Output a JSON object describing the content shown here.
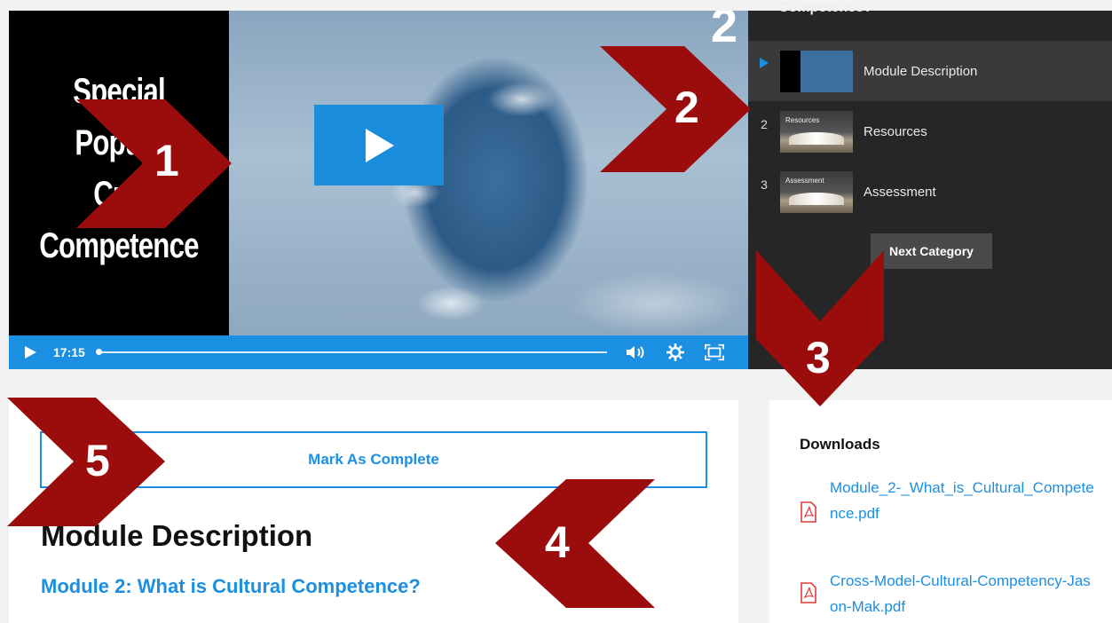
{
  "player": {
    "poster_lines": [
      "Special",
      "Popula",
      "Cult",
      "Competence"
    ],
    "corner_number": "2",
    "current_time": "17:15"
  },
  "playlist": {
    "title": "Competence?",
    "items": [
      {
        "index": "",
        "label": "Module Description",
        "thumb_text": ""
      },
      {
        "index": "2",
        "label": "Resources",
        "thumb_text": "Resources"
      },
      {
        "index": "3",
        "label": "Assessment",
        "thumb_text": "Assessment"
      }
    ],
    "next_label": "Next Category"
  },
  "main": {
    "mark_complete_label": "Mark As Complete",
    "title": "Module Description",
    "subtitle": "Module 2: What is Cultural Competence?"
  },
  "downloads": {
    "title": "Downloads",
    "files": [
      {
        "name": "Module_2-_What_is_Cultural_Competence.pdf"
      },
      {
        "name": "Cross-Model-Cultural-Competency-Jason-Mak.pdf"
      }
    ]
  },
  "annotations": {
    "markers": [
      "1",
      "2",
      "3",
      "4",
      "5"
    ],
    "color": "#9b0d0d"
  },
  "colors": {
    "accent": "#1b8fe2",
    "panel": "#262626",
    "marker": "#9b0d0d"
  }
}
